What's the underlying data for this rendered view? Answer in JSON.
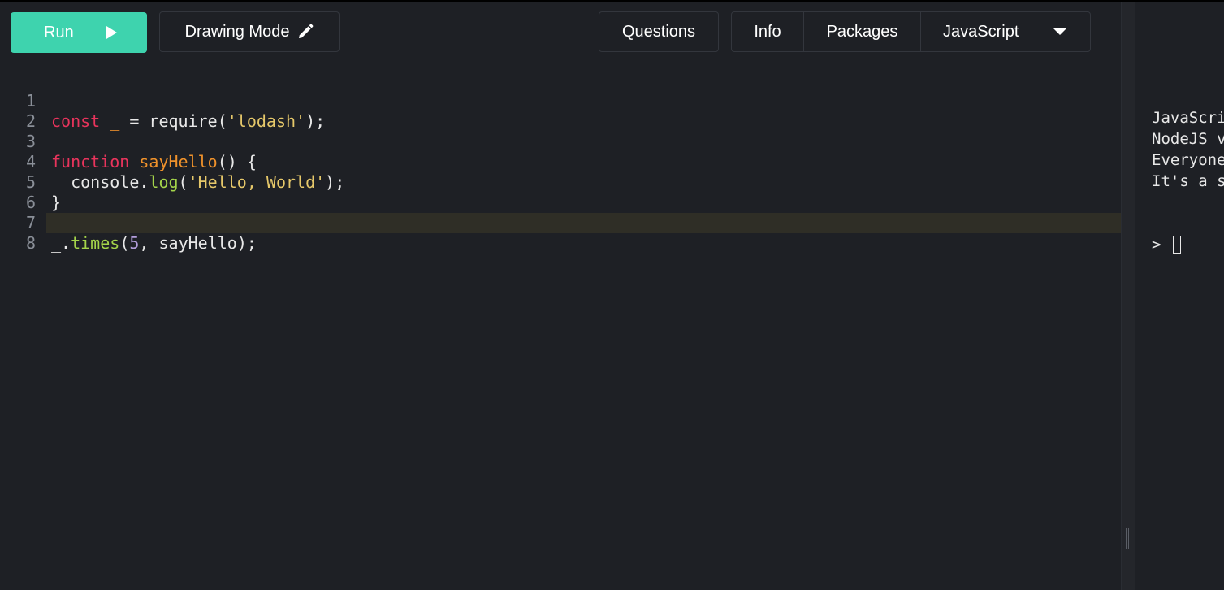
{
  "toolbar": {
    "run_label": "Run",
    "drawing_label": "Drawing Mode",
    "questions_label": "Questions",
    "info_label": "Info",
    "packages_label": "Packages",
    "language_label": "JavaScript"
  },
  "editor": {
    "line_numbers": [
      "1",
      "2",
      "3",
      "4",
      "5",
      "6",
      "7",
      "8"
    ],
    "active_line": 8,
    "tokens": {
      "l1_kw": "const",
      "l1_us": " _",
      "l1_eq": " = require(",
      "l1_str": "'lodash'",
      "l1_end": ");",
      "l3_kw": "function",
      "l3_fn": " sayHello",
      "l3_end": "() {",
      "l4_obj": "  console.",
      "l4_mth": "log",
      "l4_op": "(",
      "l4_str": "'Hello, World'",
      "l4_end": ");",
      "l5": "}",
      "l7_us": "_.",
      "l7_mth": "times",
      "l7_op": "(",
      "l7_num": "5",
      "l7_end": ", sayHello);"
    }
  },
  "console": {
    "lines": [
      "JavaScript",
      "NodeJS v",
      "Everyone",
      "It's a s"
    ],
    "prompt": ">"
  },
  "colors": {
    "run_button": "#3ed3ae",
    "background": "#1e2025",
    "keyword": "#e8345c",
    "function": "#f0922b",
    "string": "#e6c86a",
    "method": "#a4d44a",
    "number": "#b39ddb"
  },
  "icons": {
    "run": "play-icon",
    "drawing": "pencil-icon",
    "language": "chevron-down-icon"
  }
}
